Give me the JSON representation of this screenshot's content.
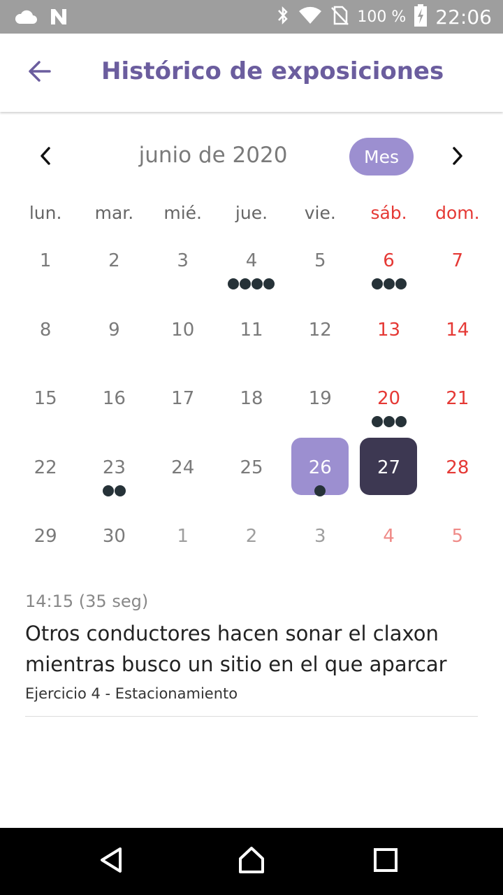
{
  "status_bar": {
    "battery": "100 %",
    "time": "22:06",
    "icons": [
      "cloud-icon",
      "n-icon",
      "bluetooth-icon",
      "wifi-icon",
      "no-sim-icon",
      "battery-charging-icon"
    ]
  },
  "app_bar": {
    "title": "Histórico de exposiciones",
    "back_icon": "arrow-left-icon",
    "title_color": "#6b5d9e"
  },
  "calendar": {
    "month_label": "junio de 2020",
    "mode_label": "Mes",
    "weekdays": [
      "lun.",
      "mar.",
      "mié.",
      "jue.",
      "vie.",
      "sáb.",
      "dom."
    ],
    "colors": {
      "accent": "#9c8fd0",
      "selected": "#3d3852",
      "weekend": "#e53935",
      "dot": "#263238"
    },
    "weeks": [
      [
        {
          "label": "1",
          "dots": 0
        },
        {
          "label": "2",
          "dots": 0
        },
        {
          "label": "3",
          "dots": 0
        },
        {
          "label": "4",
          "dots": 4
        },
        {
          "label": "5",
          "dots": 0
        },
        {
          "label": "6",
          "dots": 3
        },
        {
          "label": "7",
          "dots": 0
        }
      ],
      [
        {
          "label": "8",
          "dots": 0
        },
        {
          "label": "9",
          "dots": 0
        },
        {
          "label": "10",
          "dots": 0
        },
        {
          "label": "11",
          "dots": 0
        },
        {
          "label": "12",
          "dots": 0
        },
        {
          "label": "13",
          "dots": 0
        },
        {
          "label": "14",
          "dots": 0
        }
      ],
      [
        {
          "label": "15",
          "dots": 0
        },
        {
          "label": "16",
          "dots": 0
        },
        {
          "label": "17",
          "dots": 0
        },
        {
          "label": "18",
          "dots": 0
        },
        {
          "label": "19",
          "dots": 0
        },
        {
          "label": "20",
          "dots": 3
        },
        {
          "label": "21",
          "dots": 0
        }
      ],
      [
        {
          "label": "22",
          "dots": 0
        },
        {
          "label": "23",
          "dots": 2
        },
        {
          "label": "24",
          "dots": 0
        },
        {
          "label": "25",
          "dots": 0
        },
        {
          "label": "26",
          "dots": 1,
          "state": "highlighted"
        },
        {
          "label": "27",
          "dots": 0,
          "state": "selected"
        },
        {
          "label": "28",
          "dots": 0
        }
      ],
      [
        {
          "label": "29",
          "dots": 0
        },
        {
          "label": "30",
          "dots": 0
        },
        {
          "label": "1",
          "dots": 0,
          "other_month": true
        },
        {
          "label": "2",
          "dots": 0,
          "other_month": true
        },
        {
          "label": "3",
          "dots": 0,
          "other_month": true
        },
        {
          "label": "4",
          "dots": 0,
          "other_month": true
        },
        {
          "label": "5",
          "dots": 0,
          "other_month": true
        }
      ]
    ]
  },
  "event": {
    "time": "14:15 (35 seg)",
    "title": "Otros conductores hacen sonar el claxon mientras busco un sitio en el que aparcar",
    "subtitle": "Ejercicio 4 - Estacionamiento"
  },
  "nav_bar": {
    "icons": [
      "back-triangle-icon",
      "home-icon",
      "recents-icon"
    ]
  }
}
